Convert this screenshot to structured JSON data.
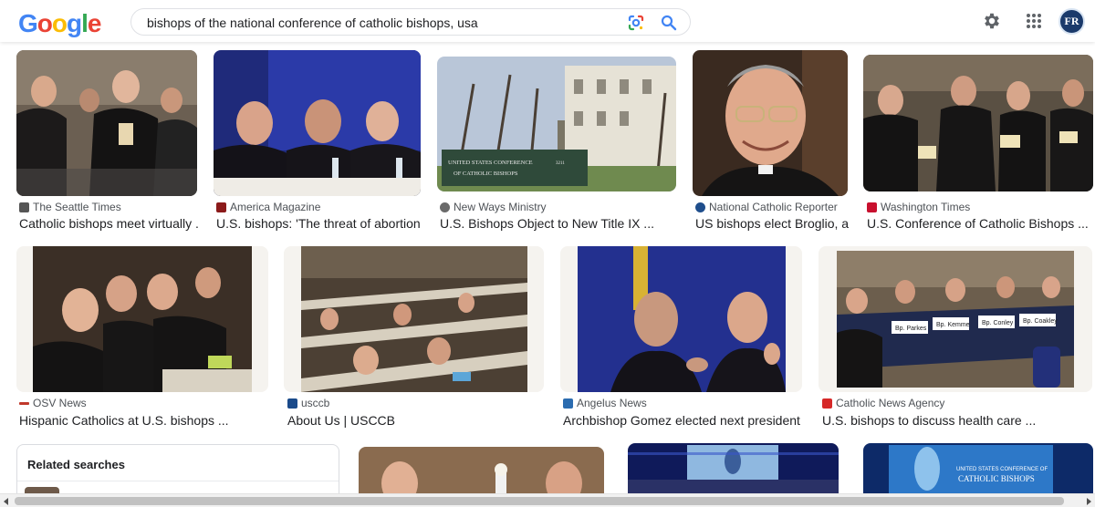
{
  "header": {
    "logo_text": "Google",
    "search_query": "bishops of the national conference of catholic bishops, usa",
    "avatar_initials": "FR",
    "icons": [
      "google-lens-icon",
      "search-icon",
      "settings-gear-icon",
      "apps-grid-icon"
    ]
  },
  "colors": {
    "favicon_seattle": "#555555",
    "favicon_america": "#8b1a1a",
    "favicon_newways": "#6a6a6a",
    "favicon_ncr": "#1f4e8c",
    "favicon_washington": "#c8102e",
    "favicon_osv": "#c0392b",
    "favicon_usccb": "#1a4a8a",
    "favicon_angelus": "#2b6cb0",
    "favicon_cna": "#d62828"
  },
  "results": [
    {
      "source": "The Seattle Times",
      "title": "Catholic bishops meet virtually ..."
    },
    {
      "source": "America Magazine",
      "title": "U.S. bishops: 'The threat of abortion ..."
    },
    {
      "source": "New Ways Ministry",
      "title": "U.S. Bishops Object to New Title IX ...",
      "sign_line1": "UNITED STATES CONFERENCE",
      "sign_line2": "OF CATHOLIC BISHOPS",
      "sign_number": "3211"
    },
    {
      "source": "National Catholic Reporter",
      "title": "US bishops elect Broglio, a..."
    },
    {
      "source": "Washington Times",
      "title": "U.S. Conference of Catholic Bishops ..."
    },
    {
      "source": "OSV News",
      "title": "Hispanic Catholics at U.S. bishops ..."
    },
    {
      "source": "usccb",
      "title": "About Us | USCCB"
    },
    {
      "source": "Angelus News",
      "title": "Archbishop Gomez elected next president ..."
    },
    {
      "source": "Catholic News Agency",
      "title": "U.S. bishops to discuss health care ...",
      "placards": [
        "Bp. Parkes",
        "Bp. Kemme",
        "Bp. Conley",
        "Bp. Coakley"
      ]
    },
    {
      "banner_line1": "UNITED STATES CONFERENCE OF",
      "banner_line2": "CATHOLIC BISHOPS"
    }
  ],
  "related": {
    "title": "Related searches"
  }
}
